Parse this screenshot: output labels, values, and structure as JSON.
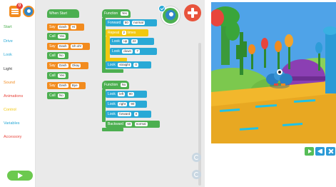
{
  "menu": {
    "badge_count": "0"
  },
  "categories": [
    {
      "label": "Start",
      "color": "#4caf50"
    },
    {
      "label": "Drive",
      "color": "#29a9d6"
    },
    {
      "label": "Look",
      "color": "#29a9d6"
    },
    {
      "label": "Light",
      "color": "#333333"
    },
    {
      "label": "Sound",
      "color": "#f28b1e"
    },
    {
      "label": "Animations",
      "color": "#e8453c"
    },
    {
      "label": "Control",
      "color": "#f2c80f"
    },
    {
      "label": "Variables",
      "color": "#29a9d6"
    },
    {
      "label": "Accessory",
      "color": "#e8453c"
    }
  ],
  "program": {
    "when_start": "When Start",
    "say1": {
      "label": "Say",
      "robot": "Dash",
      "text": "Hi"
    },
    "call1": {
      "label": "Call",
      "name": "Yes"
    },
    "say2": {
      "label": "Say",
      "robot": "Dash",
      "text": "Uh oh!"
    },
    "call2": {
      "label": "Call",
      "name": "No"
    },
    "say3": {
      "label": "Say",
      "robot": "Dash",
      "text": "Okay"
    },
    "call3": {
      "label": "Call",
      "name": "Yes"
    },
    "say4": {
      "label": "Say",
      "robot": "Dash",
      "text": "Bye"
    },
    "call4": {
      "label": "Call",
      "name": "No"
    }
  },
  "function_yes": {
    "header": "Function",
    "name": "Yes",
    "forward": {
      "label": "Forward",
      "distance": "50",
      "speed": "normal"
    },
    "repeat": {
      "label": "Repeat",
      "count": "2",
      "unit": "times"
    },
    "look_up": {
      "label": "Look",
      "dir": "up",
      "angle": "22"
    },
    "look_down": {
      "label": "Look",
      "dir": "down",
      "angle": "7"
    },
    "look_straight": {
      "label": "Look",
      "dir": "straight",
      "angle": "0"
    }
  },
  "function_no": {
    "header": "Function",
    "name": "No",
    "look_left": {
      "label": "Look",
      "dir": "left",
      "angle": "90"
    },
    "look_right": {
      "label": "Look",
      "dir": "right",
      "angle": "90"
    },
    "look_forward": {
      "label": "Look",
      "dir": "forward",
      "angle": "0"
    },
    "backward": {
      "label": "Backward",
      "distance": "50",
      "speed": "normal"
    }
  },
  "icons": {
    "menu": "hamburger-menu-icon",
    "robot": "dash-robot-icon",
    "add": "plus-icon",
    "undo": "undo-icon",
    "redo": "redo-icon"
  },
  "colors": {
    "start": "#4caf50",
    "sound": "#f28b1e",
    "look": "#29a9d6",
    "control": "#f2c80f",
    "add": "#e8543c"
  }
}
